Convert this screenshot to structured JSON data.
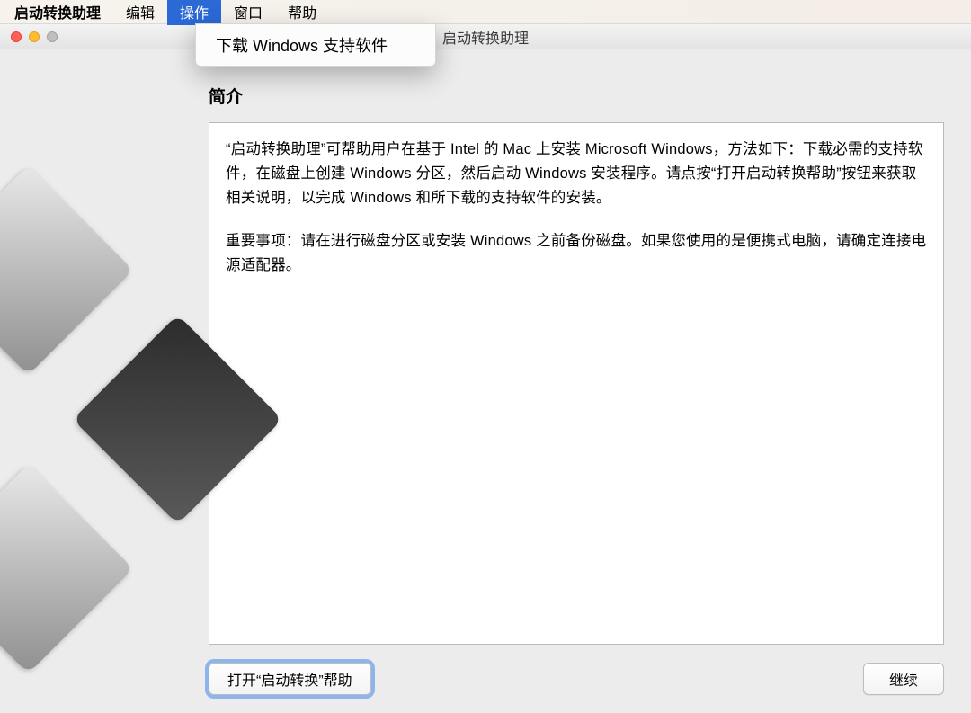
{
  "menubar": {
    "app_name": "启动转换助理",
    "items": [
      "编辑",
      "操作",
      "窗口",
      "帮助"
    ],
    "active_index": 1
  },
  "dropdown": {
    "items": [
      "下载 Windows 支持软件"
    ]
  },
  "window": {
    "title": "启动转换助理"
  },
  "main": {
    "section_title": "简介",
    "paragraph1": "“启动转换助理”可帮助用户在基于 Intel 的 Mac 上安装 Microsoft Windows，方法如下：下载必需的支持软件，在磁盘上创建 Windows 分区，然后启动 Windows 安装程序。请点按“打开启动转换帮助”按钮来获取相关说明，以完成 Windows 和所下载的支持软件的安装。",
    "paragraph2": "重要事项：请在进行磁盘分区或安装 Windows 之前备份磁盘。如果您使用的是便携式电脑，请确定连接电源适配器。"
  },
  "buttons": {
    "help": "打开“启动转换”帮助",
    "continue": "继续"
  }
}
